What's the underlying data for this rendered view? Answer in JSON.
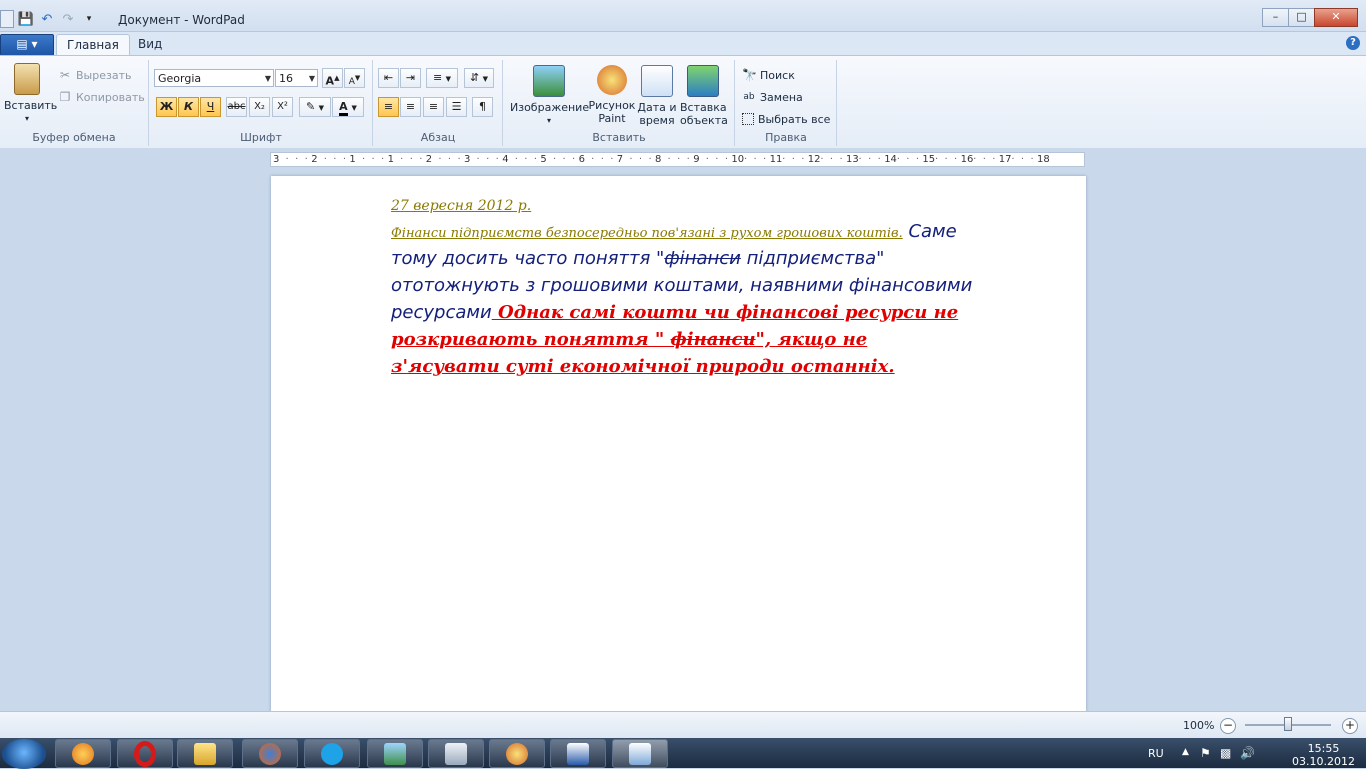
{
  "window": {
    "title": "Документ - WordPad",
    "minimize": "–",
    "maximize": "□",
    "close": "✕"
  },
  "tabs": {
    "home": "Главная",
    "view": "Вид",
    "help": "?"
  },
  "clipboard": {
    "group_title": "Буфер обмена",
    "paste": "Вставить",
    "cut": "Вырезать",
    "copy": "Копировать"
  },
  "font": {
    "group_title": "Шрифт",
    "family": "Georgia",
    "size": "16",
    "bold": "Ж",
    "italic": "К",
    "underline": "Ч",
    "strike": "abc",
    "subscript": "X₂",
    "superscript": "X²",
    "grow": "A",
    "shrink": "A",
    "color_letter": "A"
  },
  "paragraph": {
    "group_title": "Абзац"
  },
  "insert": {
    "group_title": "Вставить",
    "picture": "Изображение",
    "paint_line1": "Рисунок",
    "paint_line2": "Paint",
    "date_line1": "Дата и",
    "date_line2": "время",
    "object_line1": "Вставка",
    "object_line2": "объекта"
  },
  "editing": {
    "group_title": "Правка",
    "find": "Поиск",
    "replace": "Замена",
    "select_all": "Выбрать все"
  },
  "ruler": {
    "labels": [
      "3",
      "2",
      "1",
      "1",
      "2",
      "3",
      "4",
      "5",
      "6",
      "7",
      "8",
      "9",
      "10",
      "11",
      "12",
      "13",
      "14",
      "15",
      "16",
      "17",
      "18"
    ]
  },
  "document": {
    "date": "27 вересня 2012 р.",
    "seg1": "Фінанси підприємств безпосередньо пов'язані з рухом грошових коштів.",
    "seg2a": " Саме тому досить часто поняття \"",
    "seg2strike": "фінанси",
    "seg2b": " підприємства\" ототожнують з грошовими коштами, наявними фінансовими ресурсами",
    "seg3a": " Однак самі кошти чи фінансові ресурси не розкривають поняття \" ",
    "seg3strike": "фінанси",
    "seg3b": "\", якщо не з'ясувати суті економічної природи останніх."
  },
  "status": {
    "zoom": "100%",
    "minus": "−",
    "plus": "+"
  },
  "tray": {
    "lang": "RU",
    "time": "15:55",
    "date": "03.10.2012"
  },
  "colors": {
    "olive": "#8a7a00",
    "navy": "#14207a",
    "red": "#e00000"
  }
}
